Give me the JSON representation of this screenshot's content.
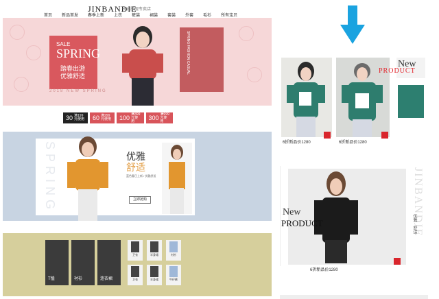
{
  "store": {
    "logo": "JINBANDIE",
    "subtitle": "卡迪旗舰专卖店",
    "nav": [
      "首页",
      "新品首发",
      "春季上新",
      "上衣",
      "裤装",
      "裙装",
      "套装",
      "外套",
      "毛衫",
      "所有宝贝"
    ]
  },
  "banner_spring": {
    "sale": "SALE",
    "title": "SPRING",
    "cn_line1": "踏春出游",
    "cn_line2": "优雅舒适",
    "caption": "2018 NEW SPRING",
    "side_text": "SPRING FASHION CASUAL"
  },
  "coupons": [
    {
      "amount": "30",
      "note": "满199元使用"
    },
    {
      "amount": "60",
      "note": "满299元使用"
    },
    {
      "amount": "100",
      "note": "满399元使用"
    },
    {
      "amount": "300",
      "note": "满999元使用"
    }
  ],
  "banner_orange": {
    "bg_word": "SPRING",
    "line1": "优雅",
    "line2": "舒适",
    "desc": "蓝色春日上新 / 优雅舒适",
    "button": "立即抢购"
  },
  "khaki_tiles": {
    "big": [
      "T恤",
      "衬衫",
      "连衣裙"
    ],
    "small": [
      "卫衣",
      "半身裙",
      "衬衫",
      "卫衣",
      "半身裙",
      "牛仔裤"
    ]
  },
  "green_card": {
    "new": "New",
    "product": "PRODUCT",
    "price1": "6折新品价1280",
    "price2": "6折新品价1280"
  },
  "black_card": {
    "new": "New",
    "product": "PRODUCT",
    "brand": "JINBANDIE",
    "tag": "优雅 · 舒适",
    "price": "6折新品价1280"
  },
  "colors": {
    "accent_red": "#d9252c",
    "arrow_blue": "#1aa3e0",
    "spring_pink": "#f6d7d8",
    "khaki": "#d6cf9c",
    "slate_blue": "#c8d4e2"
  }
}
